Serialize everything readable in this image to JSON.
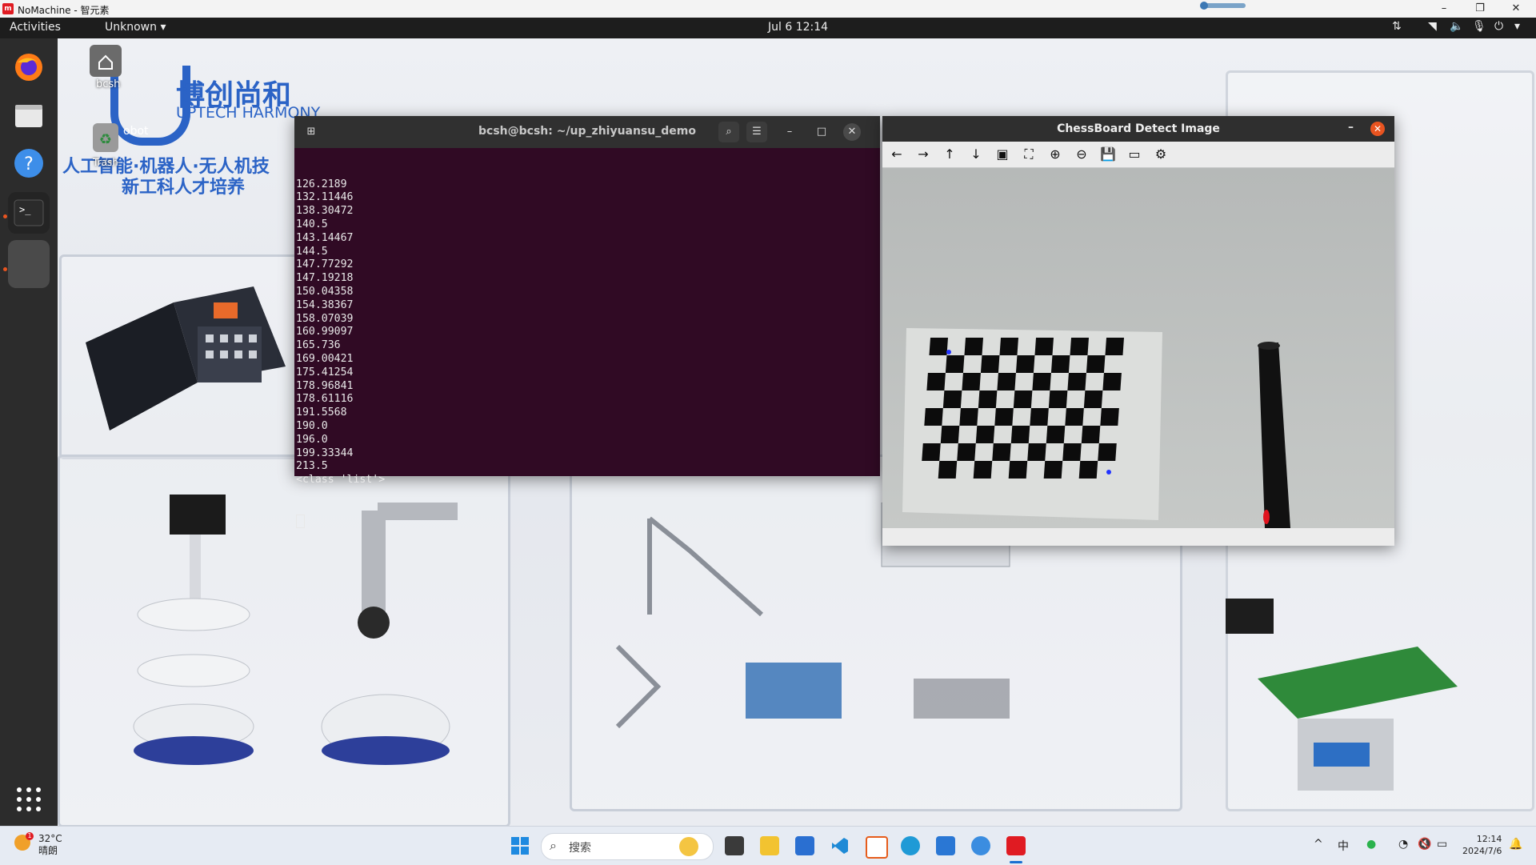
{
  "nomachine": {
    "title": "NoMachine - 智元素",
    "logo_text": "m",
    "controls": {
      "minimize": "–",
      "restore": "❐",
      "close": "✕"
    }
  },
  "gnome_bar": {
    "activities": "Activities",
    "app_menu": "Unknown ▾",
    "clock": "Jul 6  12:14",
    "tray_icons": [
      "network-wired-icon",
      "wifi-icon",
      "volume-icon",
      "microphone-icon",
      "power-icon"
    ]
  },
  "dock": {
    "items": [
      "firefox-icon",
      "files-icon",
      "help-icon",
      "terminal-icon",
      "active-app-icon",
      "show-apps-icon"
    ]
  },
  "desktop": {
    "brand_cn": "博创尚和",
    "brand_en": "UPTECH HARMONY",
    "slogan_line1": "人工智能·机器人·无人机技",
    "slogan_line2": "新工科人才培养",
    "icons": [
      {
        "label": "bcsh",
        "icon": "home-folder-icon"
      },
      {
        "label": "Trash",
        "icon": "trash-icon"
      }
    ],
    "partial_text": "obot"
  },
  "terminal": {
    "title": "bcsh@bcsh: ~/up_zhiyuansu_demo",
    "lines": [
      "126.2189",
      "132.11446",
      "138.30472",
      "140.5",
      "143.14467",
      "144.5",
      "147.77292",
      "147.19218",
      "150.04358",
      "154.38367",
      "158.07039",
      "160.99097",
      "165.736",
      "169.00421",
      "175.41254",
      "178.96841",
      "178.61116",
      "191.5568",
      "190.0",
      "196.0",
      "199.33344",
      "213.5",
      "<class 'list'>"
    ]
  },
  "cv_window": {
    "title": "ChessBoard Detect Image",
    "toolbar": [
      "pan-left-icon",
      "pan-right-icon",
      "pan-up-icon",
      "pan-down-icon",
      "zoom-original-icon",
      "zoom-fit-icon",
      "zoom-in-icon",
      "zoom-out-icon",
      "save-icon",
      "copy-icon",
      "properties-icon"
    ],
    "toolbar_glyphs": [
      "←",
      "→",
      "↑",
      "↓",
      "▣",
      "⛶",
      "⊕",
      "⊖",
      "💾",
      "▭",
      "⚙"
    ]
  },
  "taskbar": {
    "weather_temp": "32°C",
    "weather_desc": "晴朗",
    "search_placeholder": "搜索",
    "ime": "中",
    "time": "12:14",
    "date": "2024/7/6",
    "apps": [
      "start-icon",
      "search-icon",
      "task-view-icon",
      "file-explorer-icon",
      "store-icon",
      "vscode-icon",
      "office-icon",
      "edge-icon",
      "remote-icon",
      "network-app-icon",
      "nomachine-icon"
    ]
  }
}
